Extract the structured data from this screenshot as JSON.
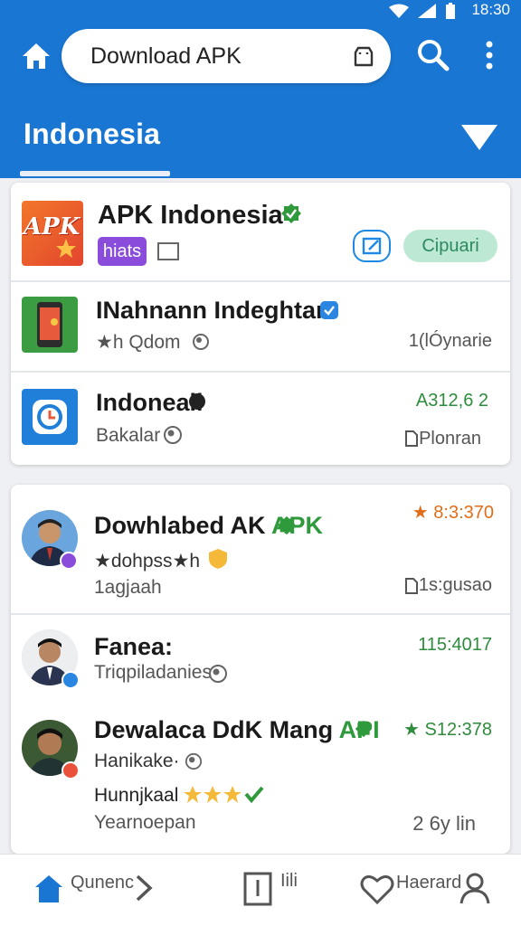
{
  "status": {
    "time": "18:30"
  },
  "header": {
    "search_text": "Download APK",
    "region_title": "Indonesia",
    "icons": [
      "home-icon",
      "bag-icon",
      "search-icon",
      "more-vertical-icon",
      "dropdown-arrow-icon"
    ]
  },
  "card1": {
    "featured": {
      "logo_text": "APK",
      "name": "APK Indonesia",
      "badge": "hiats",
      "open_label": "Cipuari",
      "icons": [
        "verified-icon",
        "tag-icon",
        "share-icon"
      ]
    },
    "apps": [
      {
        "name": "INahnann Indeghtan!",
        "meta": "★h Qdom",
        "right": "1(lÓynarie"
      },
      {
        "name": "Indoneall",
        "meta": "Bakalar",
        "right_top": "A312,6 2",
        "right_bottom": "Plonran"
      }
    ]
  },
  "card2": {
    "posts": [
      {
        "title_main": "Dowhlabed AK",
        "title_accent": "APK",
        "line2": "★dohpss★h",
        "line3": "1agjaah",
        "right_top": "★ 8:3:370",
        "right_bottom": "1s:gusao"
      },
      {
        "title_main": "Fanea:",
        "line2": "Triqpiladanies",
        "right_top": "115:4017"
      },
      {
        "title_main": "Dewalaca DdK Mang",
        "title_accent": "API",
        "line2": "Hanikake·",
        "line3": "Hunnjkaal",
        "line4": "Yearnoepan",
        "right_top": "★ S12:378",
        "right_bottom": "2 6y lin"
      }
    ]
  },
  "bottom_nav": {
    "items": [
      {
        "label": "Qunenc",
        "icon": "home-icon"
      },
      {
        "label": "Iili",
        "icon": "bookmark-icon"
      },
      {
        "label": "Haerard",
        "icon": "heart-icon"
      }
    ],
    "extra_icons": [
      "chevron-right-icon",
      "profile-icon"
    ]
  },
  "colors": {
    "primary": "#1976d2",
    "accent_green": "#2f9a3c",
    "rating_orange": "#e06d1a",
    "badge_purple": "#8a4ddb"
  }
}
